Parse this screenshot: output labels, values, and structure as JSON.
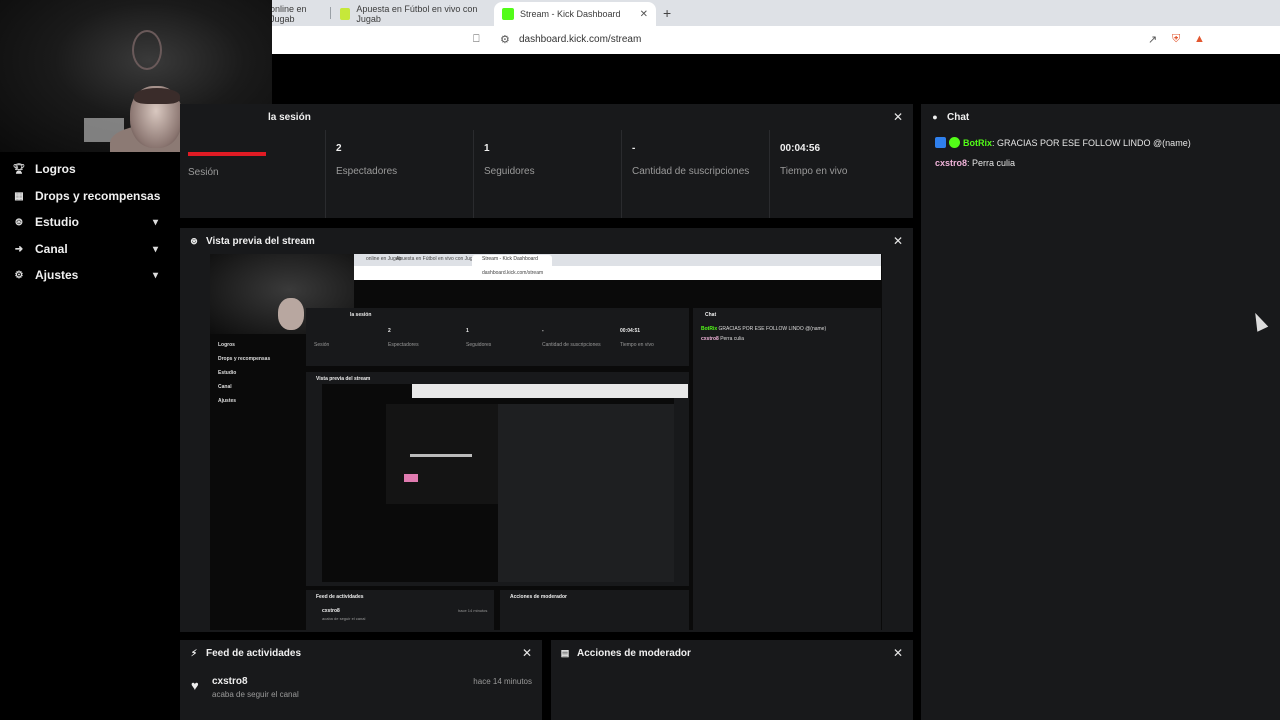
{
  "browser": {
    "tabs": [
      {
        "label": "online en Jugab"
      },
      {
        "label": "Apuesta en Fútbol en vivo con Jugab"
      },
      {
        "label": "Stream - Kick Dashboard"
      }
    ],
    "new_tab": "+",
    "url": "dashboard.kick.com/stream",
    "brave_count": "2",
    "alert_count": "1"
  },
  "sidebar": {
    "items": [
      {
        "label": "Logros",
        "icon": "trophy-icon"
      },
      {
        "label": "Drops y recompensas",
        "icon": "gift-icon"
      },
      {
        "label": "Estudio",
        "icon": "studio-icon",
        "expandable": true
      },
      {
        "label": "Canal",
        "icon": "channel-icon",
        "expandable": true
      },
      {
        "label": "Ajustes",
        "icon": "gear-icon",
        "expandable": true
      }
    ]
  },
  "session": {
    "title": "la sesión",
    "stats": [
      {
        "value": "",
        "label": "Sesión"
      },
      {
        "value": "2",
        "label": "Espectadores"
      },
      {
        "value": "1",
        "label": "Seguidores"
      },
      {
        "value": "-",
        "label": "Cantidad de suscripciones"
      },
      {
        "value": "00:04:56",
        "label": "Tiempo en vivo"
      }
    ]
  },
  "preview": {
    "title": "Vista previa del stream"
  },
  "feed": {
    "title": "Feed de actividades",
    "items": [
      {
        "user": "cxstro8",
        "text": "acaba de seguir el canal",
        "time": "hace 14 minutos"
      }
    ]
  },
  "mod": {
    "title": "Acciones de moderador"
  },
  "chat": {
    "title": "Chat",
    "messages": [
      {
        "user": "BotRix",
        "text": "GRACIAS POR ESE FOLLOW LINDO @(name)"
      },
      {
        "user": "cxstro8",
        "text": "Perra culia"
      }
    ]
  },
  "nested": {
    "url": "dashboard.kick.com/stream",
    "tab": "Stream - Kick Dashboard",
    "tab2": "Apuesta en Fútbol en vivo con Jugab",
    "tab1": "online en Jugab",
    "sidebar": [
      "Logros",
      "Drops y recompensas",
      "Estudio",
      "Canal",
      "Ajustes"
    ],
    "session_title": "la sesión",
    "stats": [
      {
        "value": "",
        "label": "Sesión"
      },
      {
        "value": "2",
        "label": "Espectadores"
      },
      {
        "value": "1",
        "label": "Seguidores"
      },
      {
        "value": "-",
        "label": "Cantidad de suscripciones"
      },
      {
        "value": "00:04:51",
        "label": "Tiempo en vivo"
      }
    ],
    "preview_title": "Vista previa del stream",
    "chat_title": "Chat",
    "chat_msg1_user": "BotRix",
    "chat_msg1_text": "GRACIAS POR ESE FOLLOW LINDO @(name)",
    "chat_msg2_user": "cxstro8",
    "chat_msg2_text": "Perra culia",
    "feed_title": "Feed de actividades",
    "feed_user": "cxstro8",
    "feed_text": "acaba de seguir el canal",
    "feed_time": "hace 14 minutos",
    "mod_title": "Acciones de moderador"
  },
  "colors": {
    "accent": "#53fc18",
    "red": "#e01b24",
    "panel": "#18191b"
  }
}
